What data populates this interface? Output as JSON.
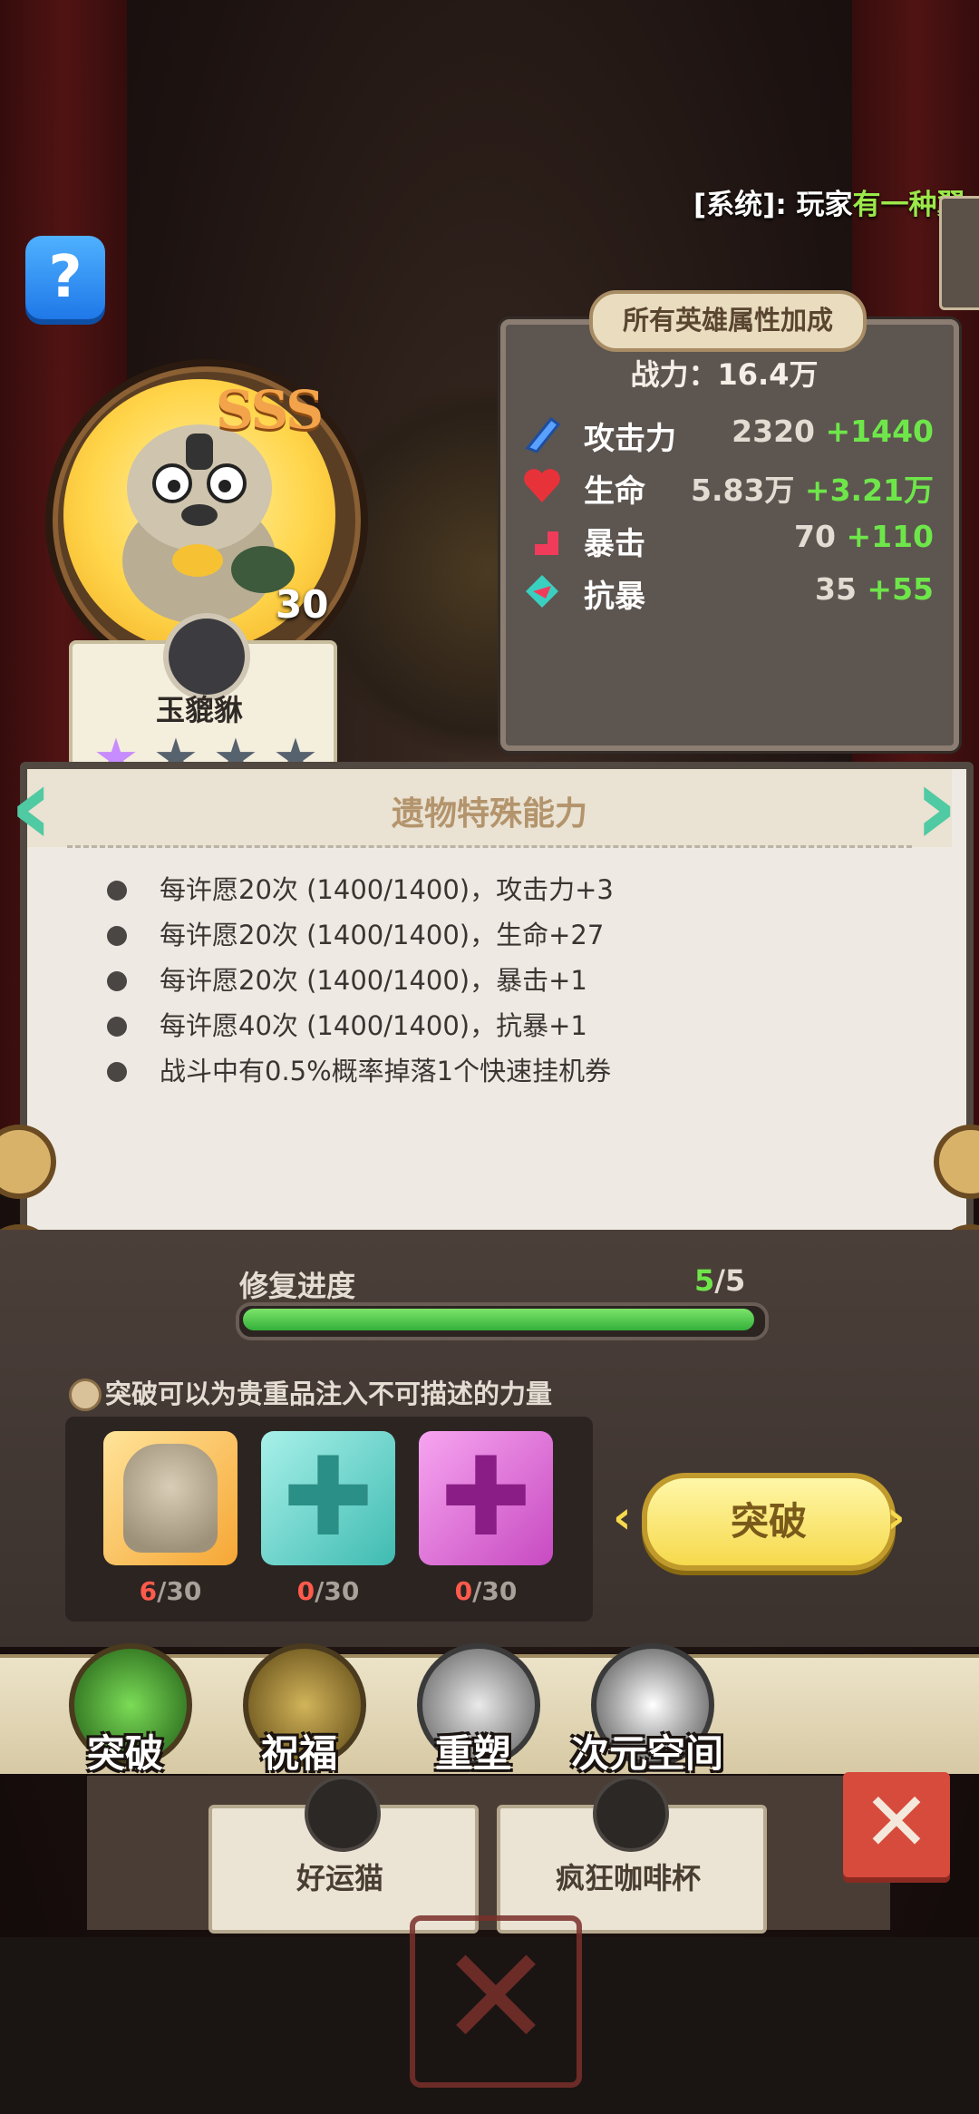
{
  "system_message": {
    "prefix": "[系统]: 玩家",
    "highlight": "有一种翼"
  },
  "help": {
    "label": "?"
  },
  "hero": {
    "rank": "SSS",
    "level": "30",
    "name": "玉貔貅",
    "stars_total": 4,
    "stars_special": 1
  },
  "stats_panel": {
    "title": "所有英雄属性加成",
    "power": "战力：16.4万",
    "rows": [
      {
        "icon": "attack-icon",
        "label": "攻击力",
        "base": "2320",
        "bonus": "+1440"
      },
      {
        "icon": "heart-icon",
        "label": "生命",
        "base": "5.83万",
        "bonus": "+3.21万"
      },
      {
        "icon": "crit-icon",
        "label": "暴击",
        "base": "70",
        "bonus": "+110"
      },
      {
        "icon": "anti-crit-icon",
        "label": "抗暴",
        "base": "35",
        "bonus": "+55"
      }
    ]
  },
  "relic_panel": {
    "title": "遗物特殊能力",
    "abilities": [
      "每许愿20次 (1400/1400)，攻击力+3",
      "每许愿20次 (1400/1400)，生命+27",
      "每许愿20次 (1400/1400)，暴击+1",
      "每许愿40次 (1400/1400)，抗暴+1",
      "战斗中有0.5%概率掉落1个快速挂机券"
    ]
  },
  "repair": {
    "label": "修复进度",
    "current": "5",
    "total": "/5",
    "progress_fraction": 1.0
  },
  "breakthrough": {
    "hint": "突破可以为贵重品注入不可描述的力量",
    "materials": [
      {
        "name": "hero-shard",
        "current": "6",
        "required": "/30"
      },
      {
        "name": "teal-cross",
        "current": "0",
        "required": "/30"
      },
      {
        "name": "pink-cross",
        "current": "0",
        "required": "/30"
      }
    ],
    "button_label": "突破",
    "arrow_left": "‹",
    "arrow_right": "›"
  },
  "tabs": [
    {
      "label": "突破"
    },
    {
      "label": "祝福"
    },
    {
      "label": "重塑"
    },
    {
      "label": "次元空间"
    }
  ],
  "under_cards": [
    {
      "name": "好运猫"
    },
    {
      "name": "疯狂咖啡杯"
    }
  ],
  "colors": {
    "bonus_green": "#6ee64a",
    "accent_teal": "#4fcaa2",
    "button_yellow": "#f6d94c",
    "close_red": "#d74b3c"
  }
}
